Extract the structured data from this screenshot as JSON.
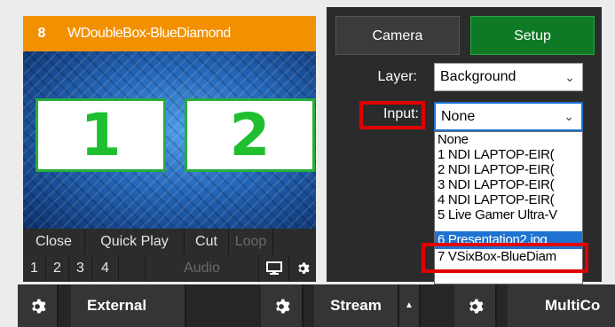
{
  "input_card": {
    "number": "8",
    "title": "WDoubleBox-BlueDiamond",
    "preview": {
      "box1": "1",
      "box2": "2"
    },
    "controls_row1": [
      "Close",
      "Quick Play",
      "Cut",
      "Loop"
    ],
    "controls_row2": [
      "1",
      "2",
      "3",
      "4",
      "Audio"
    ],
    "icons": {
      "display": "monitor-icon",
      "settings": "gear-icon"
    }
  },
  "right_panel": {
    "camera_tab": "Camera",
    "setup_tab": "Setup",
    "layer_label": "Layer:",
    "layer_value": "Background",
    "input_label": "Input:",
    "input_value": "None",
    "dropdown_options": [
      "None",
      "1 NDI LAPTOP-EIR(",
      "2 NDI LAPTOP-EIR(",
      "3 NDI LAPTOP-EIR(",
      "4 NDI LAPTOP-EIR(",
      "5 Live Gamer Ultra-V",
      "6 Presentation2.jpg",
      "7 VSixBox-BlueDiam"
    ],
    "selected_option": "6 Presentation2.jpg"
  },
  "bottom_bar": {
    "external": "External",
    "stream": "Stream",
    "stream_caret": "▲",
    "multicorder": "MultiCo"
  },
  "colors": {
    "header_orange": "#f39000",
    "setup_green": "#0f7a25",
    "highlight_red": "#e00000",
    "select_blue": "#1e73d2",
    "box_green": "#1fbf2f"
  }
}
